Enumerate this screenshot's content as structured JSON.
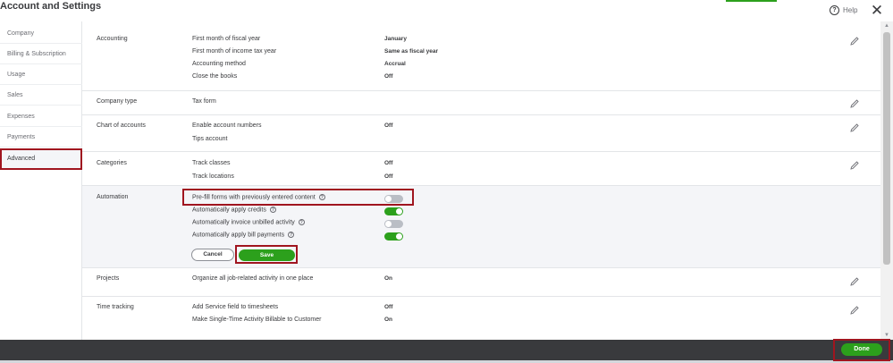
{
  "header": {
    "title": "Account and Settings",
    "help_label": "Help",
    "help_icon": "question-circle-icon",
    "close_icon": "close-x-icon"
  },
  "sidebar": {
    "items": [
      {
        "label": "Company"
      },
      {
        "label": "Billing & Subscription"
      },
      {
        "label": "Usage"
      },
      {
        "label": "Sales"
      },
      {
        "label": "Expenses"
      },
      {
        "label": "Payments"
      },
      {
        "label": "Advanced"
      }
    ],
    "selected": "Advanced"
  },
  "sections": {
    "accounting": {
      "label": "Accounting",
      "rows": [
        {
          "label": "First month of fiscal year",
          "value": "January"
        },
        {
          "label": "First month of income tax year",
          "value": "Same as fiscal year"
        },
        {
          "label": "Accounting method",
          "value": "Accrual"
        },
        {
          "label": "Close the books",
          "value": "Off"
        }
      ]
    },
    "company_type": {
      "label": "Company type",
      "rows": [
        {
          "label": "Tax form",
          "value": ""
        }
      ]
    },
    "chart_of_accounts": {
      "label": "Chart of accounts",
      "rows": [
        {
          "label": "Enable account numbers",
          "value": "Off"
        },
        {
          "label": "Tips account",
          "value": ""
        }
      ]
    },
    "categories": {
      "label": "Categories",
      "rows": [
        {
          "label": "Track classes",
          "value": "Off"
        },
        {
          "label": "Track locations",
          "value": "Off"
        }
      ]
    },
    "automation": {
      "label": "Automation",
      "rows": [
        {
          "label": "Pre-fill forms with previously entered content",
          "state": "off"
        },
        {
          "label": "Automatically apply credits",
          "state": "on"
        },
        {
          "label": "Automatically invoice unbilled activity",
          "state": "off"
        },
        {
          "label": "Automatically apply bill payments",
          "state": "on"
        }
      ],
      "cancel_label": "Cancel",
      "save_label": "Save"
    },
    "projects": {
      "label": "Projects",
      "rows": [
        {
          "label": "Organize all job-related activity in one place",
          "value": "On"
        }
      ]
    },
    "time_tracking": {
      "label": "Time tracking",
      "rows": [
        {
          "label": "Add Service field to timesheets",
          "value": "Off"
        },
        {
          "label": "Make Single-Time Activity Billable to Customer",
          "value": "On"
        }
      ]
    }
  },
  "footer": {
    "done_label": "Done"
  },
  "colors": {
    "brand_green": "#2ca01c",
    "highlight_red": "#a0151f",
    "footer_dark": "#393a3d",
    "toggle_off": "#babec5"
  },
  "icons": {
    "edit": "pencil-icon",
    "info": "info-circle-icon"
  }
}
